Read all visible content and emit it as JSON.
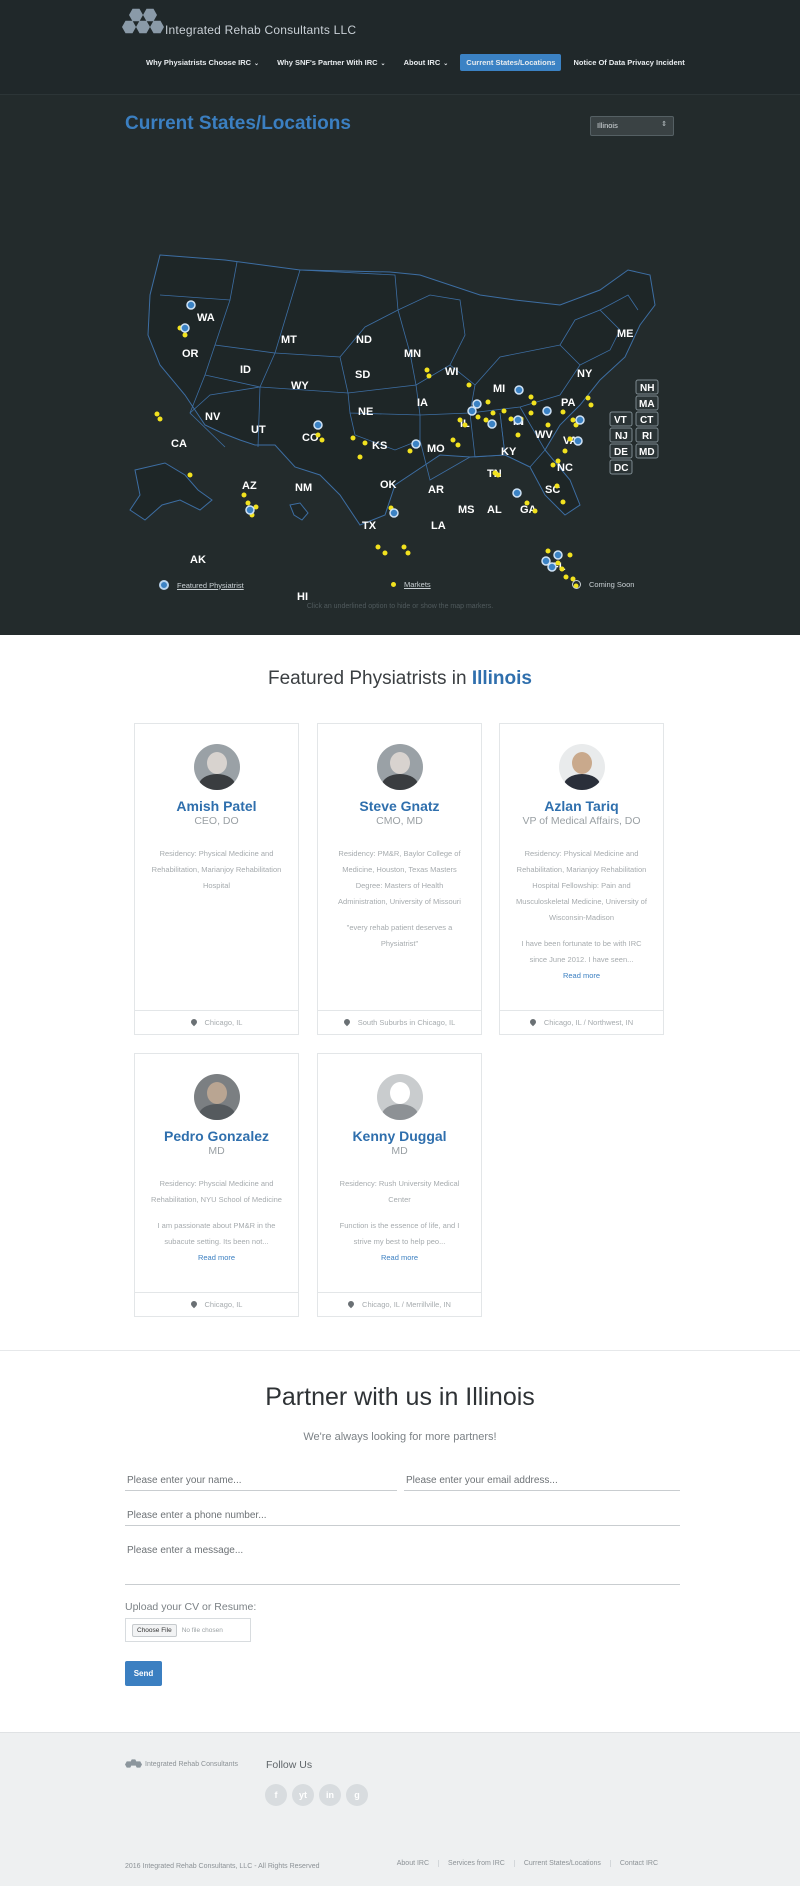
{
  "header": {
    "brand": "Integrated Rehab Consultants LLC",
    "nav": [
      {
        "label": "Why Physiatrists Choose IRC",
        "has_dropdown": true,
        "active": false
      },
      {
        "label": "Why SNF's Partner With IRC",
        "has_dropdown": true,
        "active": false
      },
      {
        "label": "About IRC",
        "has_dropdown": true,
        "active": false
      },
      {
        "label": "Current States/Locations",
        "has_dropdown": false,
        "active": true
      },
      {
        "label": "Notice Of Data Privacy Incident",
        "has_dropdown": false,
        "active": false
      }
    ]
  },
  "map_section": {
    "title": "Current States/Locations",
    "state_select": {
      "selected": "Illinois"
    },
    "states": [
      "WA",
      "OR",
      "CA",
      "ID",
      "NV",
      "MT",
      "WY",
      "UT",
      "AZ",
      "CO",
      "NM",
      "ND",
      "SD",
      "NE",
      "KS",
      "OK",
      "TX",
      "MN",
      "IA",
      "MO",
      "AR",
      "LA",
      "WI",
      "IL",
      "MI",
      "IN",
      "OH",
      "KY",
      "TN",
      "MS",
      "AL",
      "GA",
      "FL",
      "SC",
      "NC",
      "VA",
      "WV",
      "PA",
      "NY",
      "ME",
      "AK",
      "HI"
    ],
    "boxed_states": [
      "NH",
      "MA",
      "VT",
      "CT",
      "NJ",
      "RI",
      "DE",
      "MD",
      "DC"
    ],
    "legend": {
      "featured": "Featured Physiatrist",
      "markets": "Markets",
      "coming_soon": "Coming Soon"
    },
    "hint": "Click an underlined option to hide or show the map markers."
  },
  "featured": {
    "title_prefix": "Featured Physiatrists in ",
    "title_state": "Illinois",
    "doctors": [
      {
        "name": "Amish Patel",
        "role": "CEO, DO",
        "bio": "Residency: Physical Medicine and Rehabilitation, Marianjoy Rehabilitation Hospital",
        "quote": "",
        "read_more": "",
        "location": "Chicago, IL"
      },
      {
        "name": "Steve Gnatz",
        "role": "CMO, MD",
        "bio": "Residency: PM&R, Baylor College of Medicine, Houston, Texas Masters Degree: Masters of Health Administration, University of Missouri",
        "quote": "\"every rehab patient deserves a Physiatrist\"",
        "read_more": "",
        "location": "South Suburbs in Chicago, IL"
      },
      {
        "name": "Azlan Tariq",
        "role": "VP of Medical Affairs, DO",
        "bio": "Residency: Physical Medicine and Rehabilitation, Marianjoy Rehabilitation Hospital Fellowship: Pain and Musculoskeletal Medicine, University of Wisconsin-Madison",
        "quote": "I have been fortunate to be with IRC since June 2012. I have seen...",
        "read_more": "Read more",
        "location": "Chicago, IL / Northwest, IN"
      },
      {
        "name": "Pedro Gonzalez",
        "role": "MD",
        "bio": "Residency: Physcial Medicine and Rehabilitation, NYU School of Medicine",
        "quote": "I am passionate about PM&R in the subacute setting. Its been not...",
        "read_more": "Read more",
        "location": "Chicago, IL"
      },
      {
        "name": "Kenny Duggal",
        "role": "MD",
        "bio": "Residency: Rush University Medical Center",
        "quote": "Function is the essence of life, and I strive my best to help peo...",
        "read_more": "Read more",
        "location": "Chicago, IL / Merrillville, IN"
      }
    ]
  },
  "partner": {
    "title": "Partner with us in Illinois",
    "subtitle": "We're always looking for more partners!",
    "name_placeholder": "Please enter your name...",
    "email_placeholder": "Please enter your email address...",
    "phone_placeholder": "Please enter a phone number...",
    "message_placeholder": "Please enter a message...",
    "upload_label": "Upload your CV or Resume:",
    "file_button": "Choose File",
    "file_status": "No file chosen",
    "send_label": "Send"
  },
  "footer": {
    "brand": "Integrated Rehab Consultants",
    "follow": "Follow Us",
    "social": [
      "f",
      "yt",
      "in",
      "g"
    ],
    "copyright": "2016 Integrated Rehab Consultants, LLC - All Rights Reserved",
    "links": [
      "About IRC",
      "Services from IRC",
      "Current States/Locations",
      "Contact IRC"
    ]
  },
  "colors": {
    "accent_blue": "#3b7fc1",
    "market_yellow": "#f2e21f",
    "map_bg": "#232b2c"
  }
}
